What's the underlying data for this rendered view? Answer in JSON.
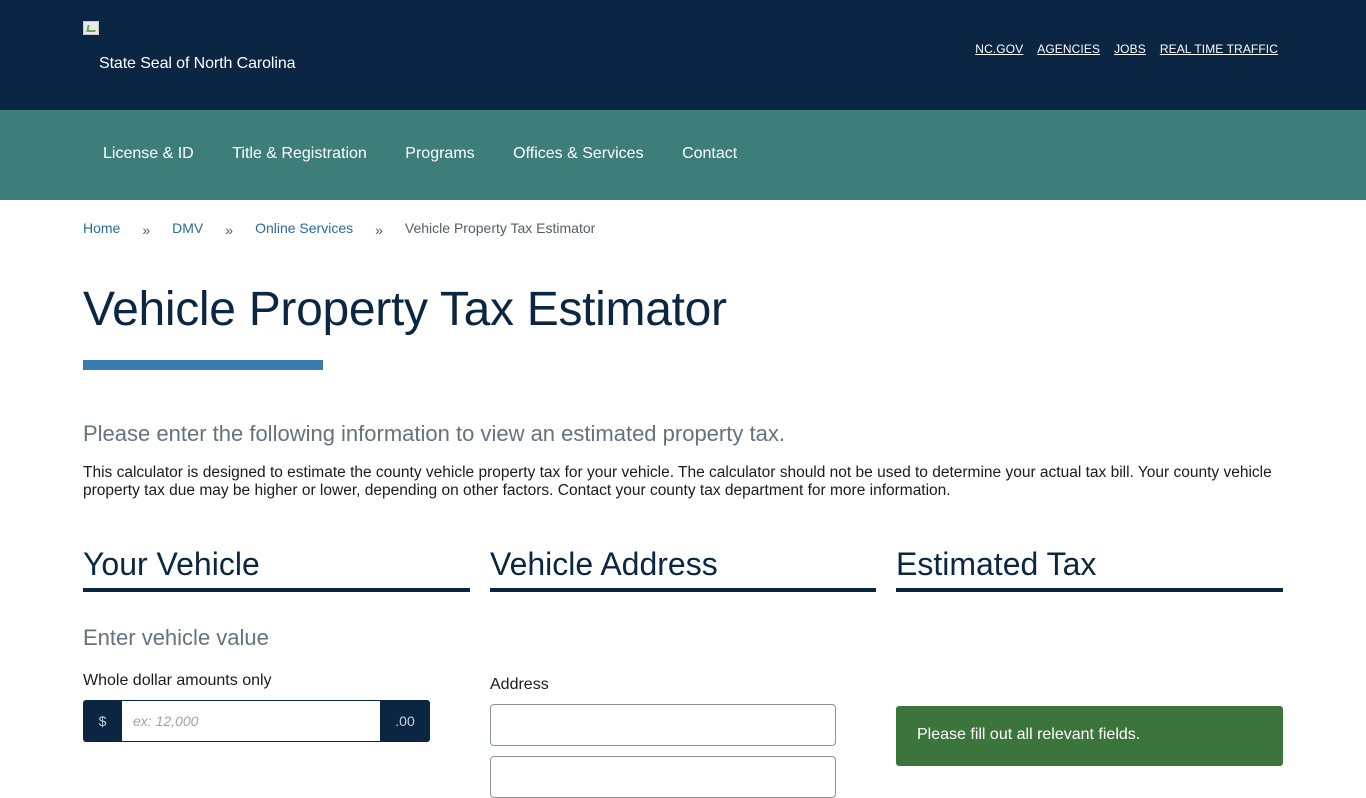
{
  "header": {
    "logo_alt": "State Seal of North Carolina",
    "utility_links": [
      "NC.GOV",
      "AGENCIES",
      "JOBS",
      "REAL TIME TRAFFIC"
    ]
  },
  "main_nav": [
    "License & ID",
    "Title & Registration",
    "Programs",
    "Offices & Services",
    "Contact"
  ],
  "breadcrumb": {
    "items": [
      "Home",
      "DMV",
      "Online Services"
    ],
    "separator": "»",
    "current": "Vehicle Property Tax Estimator"
  },
  "page": {
    "title": "Vehicle Property Tax Estimator",
    "lead": "Please enter the following information to view an estimated property tax.",
    "intro": "This calculator is designed to estimate the county vehicle property tax for your vehicle. The calculator should not be used to determine your actual tax bill. Your county vehicle property tax due may be higher or lower, depending on other factors. Contact your county tax department for more information."
  },
  "vehicle": {
    "heading": "Your Vehicle",
    "subheading": "Enter vehicle value",
    "value_label": "Whole dollar amounts only",
    "prefix": "$",
    "placeholder": "ex: 12,000",
    "suffix": ".00"
  },
  "address": {
    "heading": "Vehicle Address",
    "label": "Address"
  },
  "estimate": {
    "heading": "Estimated Tax",
    "message": "Please fill out all relevant fields."
  },
  "colors": {
    "header_bg": "#0b2642",
    "nav_bg": "#3d7d7a",
    "accent_bar": "#3b7aad",
    "alert_bg": "#3b753c"
  }
}
